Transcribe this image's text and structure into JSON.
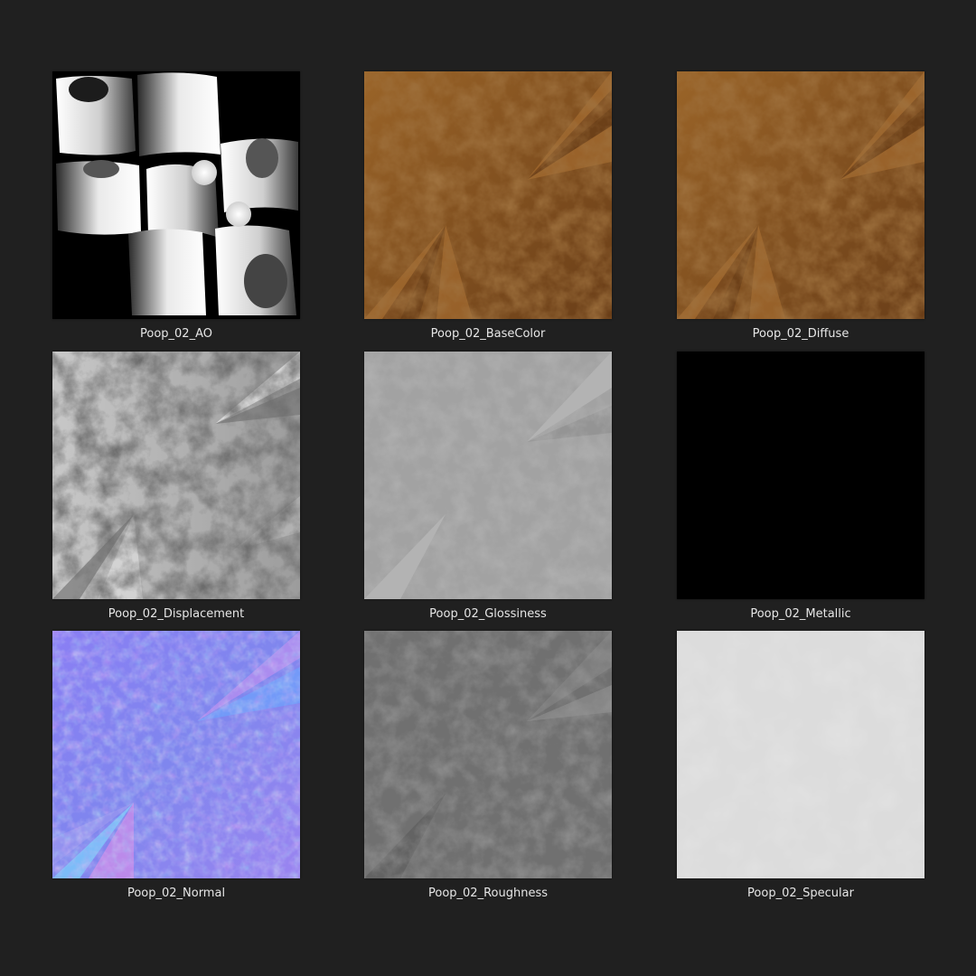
{
  "background_color": "#202020",
  "tiles": [
    {
      "label": "Poop_02_AO",
      "icon": "ambient-occlusion-map",
      "color": "#000000"
    },
    {
      "label": "Poop_02_BaseColor",
      "icon": "base-color-map",
      "color": "#7a4a1e"
    },
    {
      "label": "Poop_02_Diffuse",
      "icon": "diffuse-map",
      "color": "#7a4a1e"
    },
    {
      "label": "Poop_02_Displacement",
      "icon": "displacement-map",
      "color": "#a8a8a8"
    },
    {
      "label": "Poop_02_Glossiness",
      "icon": "glossiness-map",
      "color": "#9a9a9a"
    },
    {
      "label": "Poop_02_Metallic",
      "icon": "metallic-map",
      "color": "#000000"
    },
    {
      "label": "Poop_02_Normal",
      "icon": "normal-map",
      "color": "#8a7ef0"
    },
    {
      "label": "Poop_02_Roughness",
      "icon": "roughness-map",
      "color": "#6e6e6e"
    },
    {
      "label": "Poop_02_Specular",
      "icon": "specular-map",
      "color": "#dcdcdc"
    }
  ]
}
